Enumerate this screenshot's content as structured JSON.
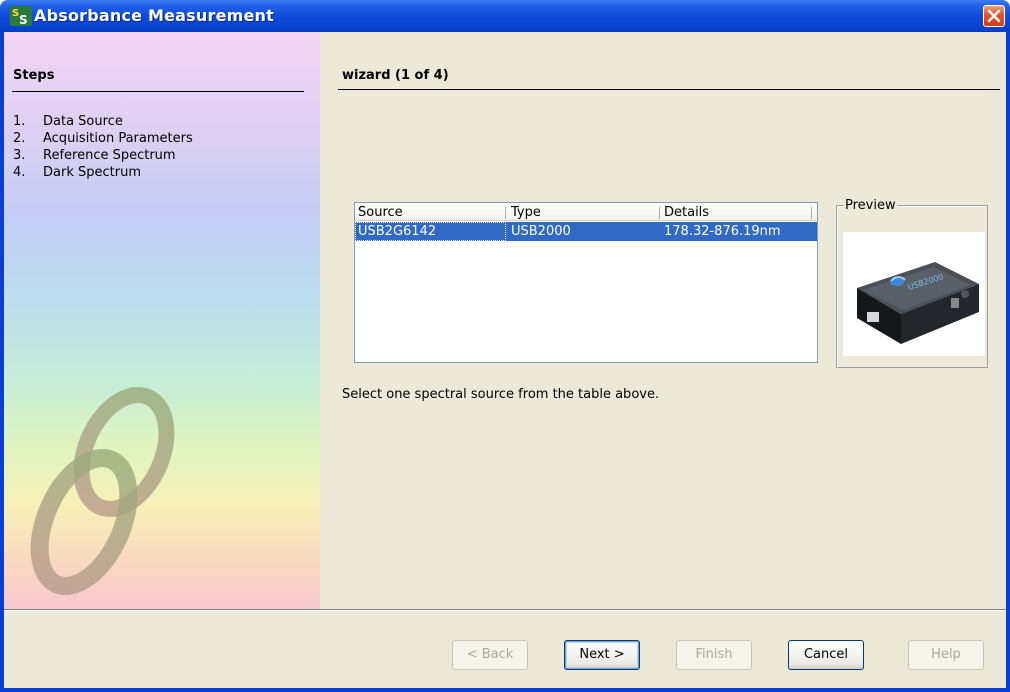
{
  "window": {
    "title": "Absorbance Measurement"
  },
  "steps": {
    "header": "Steps",
    "items": [
      {
        "num": "1.",
        "label": "Data Source"
      },
      {
        "num": "2.",
        "label": "Acquisition Parameters"
      },
      {
        "num": "3.",
        "label": "Reference Spectrum"
      },
      {
        "num": "4.",
        "label": "Dark Spectrum"
      }
    ]
  },
  "wizard": {
    "header": "wizard (1 of 4)"
  },
  "table": {
    "columns": [
      "Source",
      "Type",
      "Details"
    ],
    "rows": [
      {
        "source": "USB2G6142",
        "type": "USB2000",
        "details": "178.32-876.19nm",
        "selected": true
      }
    ]
  },
  "hint": "Select one spectral source from the table above.",
  "preview": {
    "label": "Preview",
    "device_label": "USB2000"
  },
  "buttons": {
    "back": "< Back",
    "next": "Next >",
    "finish": "Finish",
    "cancel": "Cancel",
    "help": "Help"
  },
  "colors": {
    "titlebar": "#0a3fd6",
    "selection": "#316ac5",
    "dialog_bg": "#ece9d8"
  }
}
